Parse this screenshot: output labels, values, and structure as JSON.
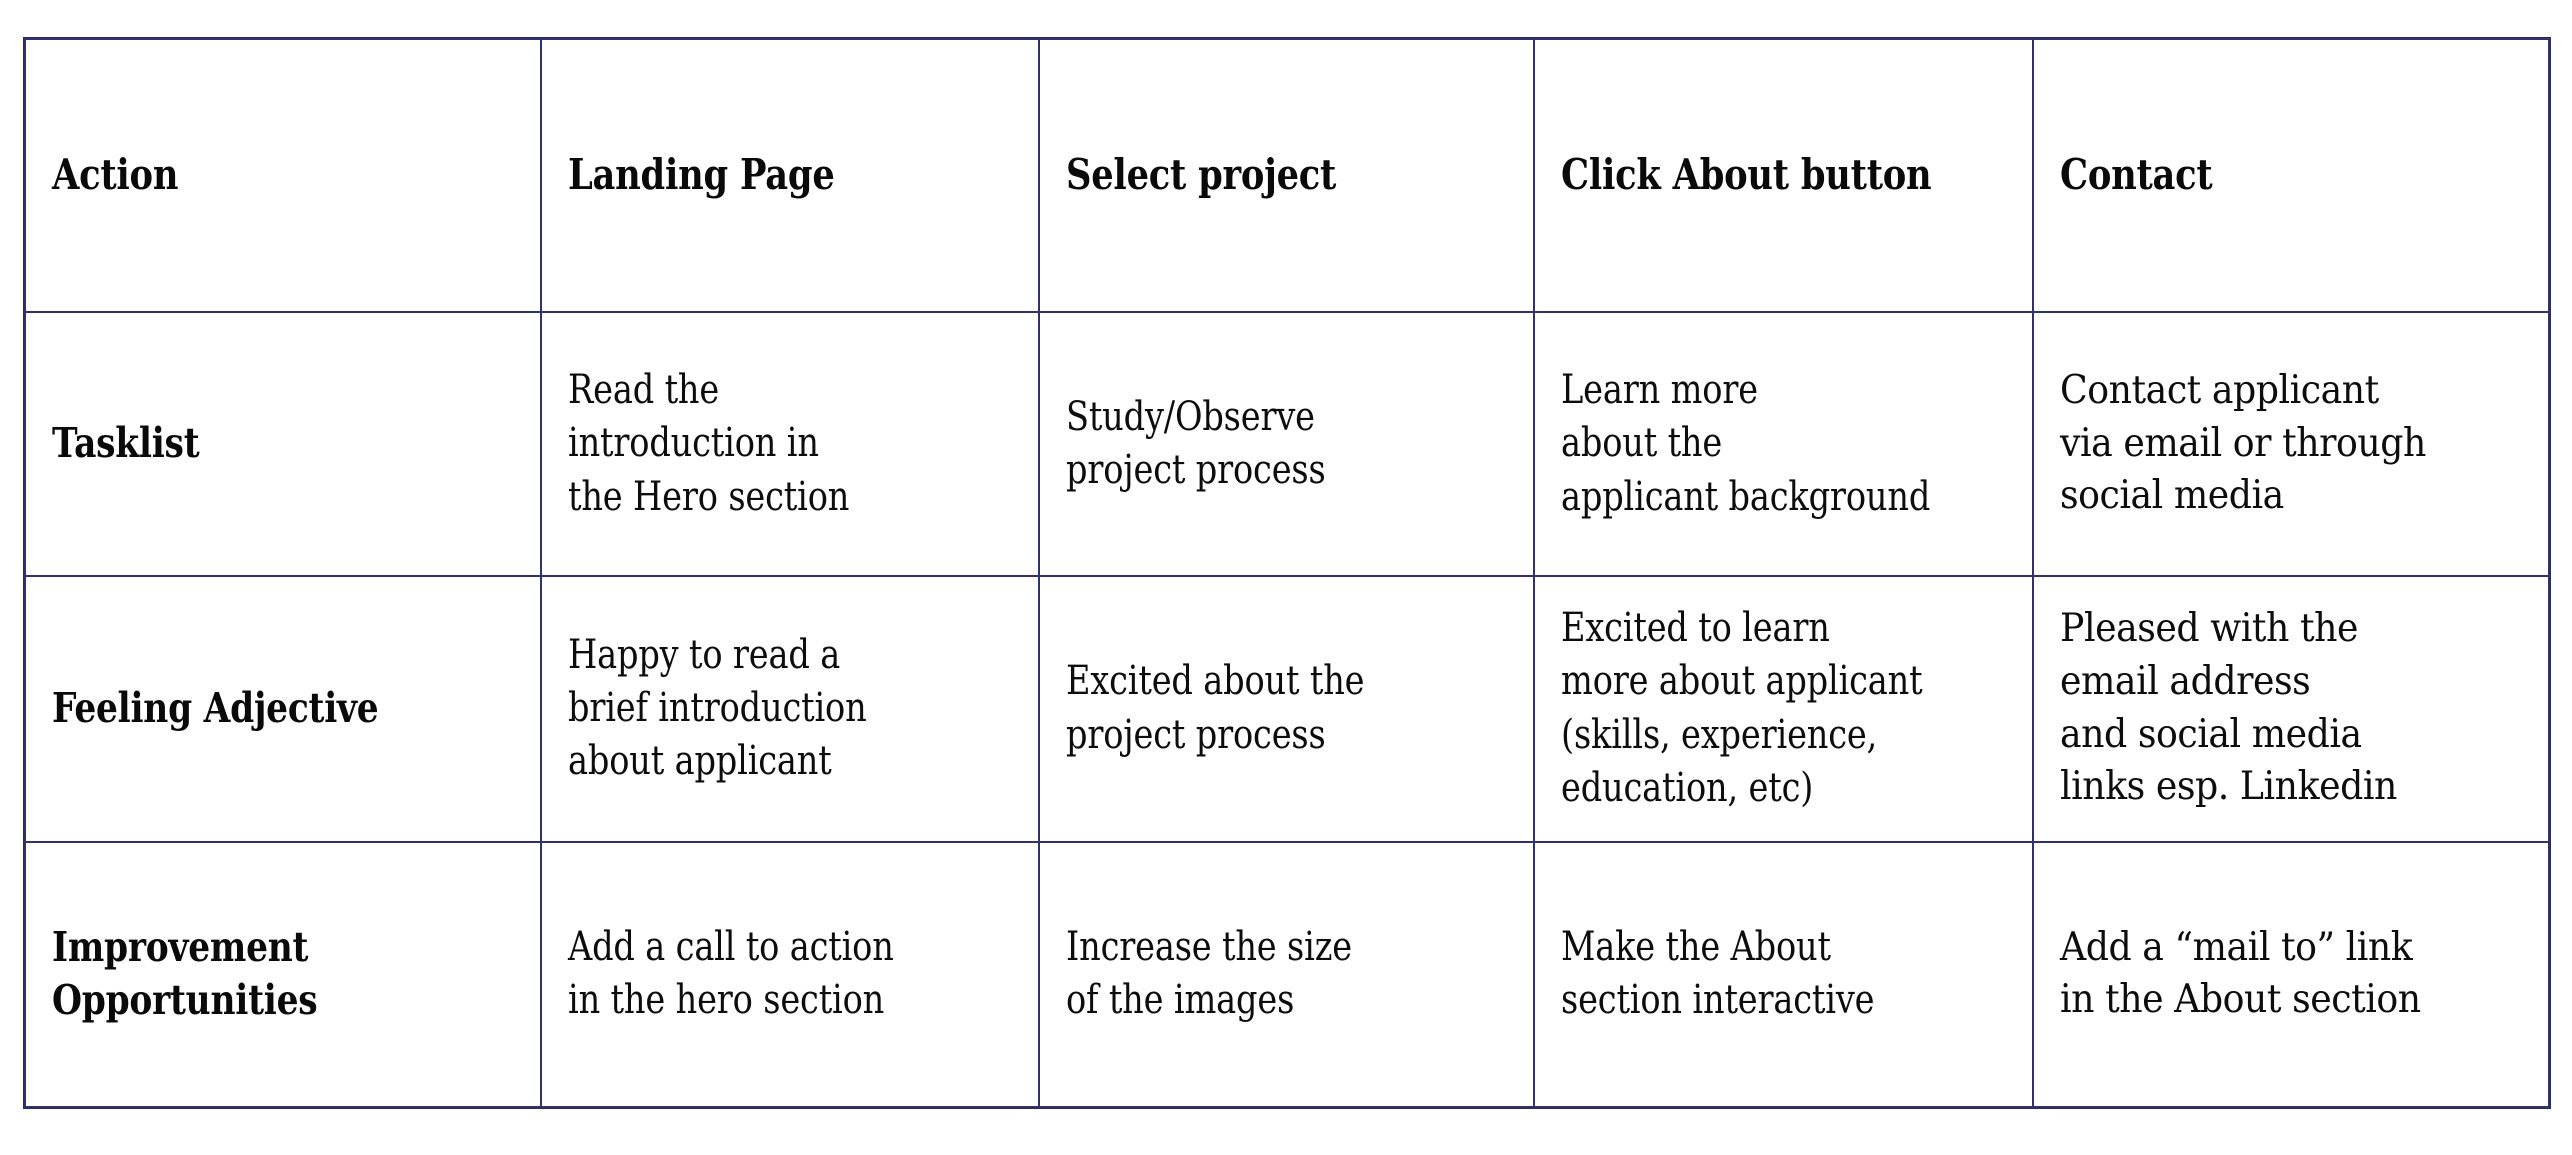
{
  "table": {
    "border_color": "#32326a",
    "columns": [
      {
        "key": "action",
        "header": "Action"
      },
      {
        "key": "landing",
        "header": "Landing Page"
      },
      {
        "key": "select",
        "header": "Select project"
      },
      {
        "key": "about",
        "header": "Click About button"
      },
      {
        "key": "contact",
        "header": "Contact"
      }
    ],
    "rows": [
      {
        "label": "Tasklist",
        "cells": [
          "Read the\nintroduction in\nthe Hero section",
          "Study/Observe\nproject process",
          "Learn more\nabout the\napplicant background",
          "Contact applicant\nvia email or through\nsocial media"
        ]
      },
      {
        "label": "Feeling Adjective",
        "cells": [
          "Happy to read a\nbrief introduction\nabout applicant",
          "Excited about the\nproject process",
          "Excited to learn\nmore about applicant\n(skills, experience,\neducation, etc)",
          "Pleased with the\nemail address\nand social media\nlinks esp. Linkedin"
        ]
      },
      {
        "label": "Improvement\nOpportunities",
        "cells": [
          "Add a call to action\nin the hero section",
          "Increase the size\nof the images",
          "Make the About\nsection  interactive",
          "Add a “mail to” link\nin the About section"
        ]
      }
    ]
  }
}
